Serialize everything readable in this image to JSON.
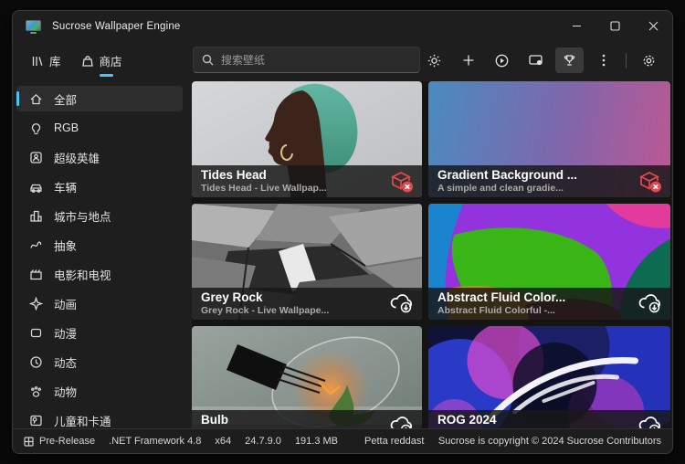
{
  "window": {
    "title": "Sucrose Wallpaper Engine"
  },
  "titlebar": {
    "controls": {
      "minimize": "minimize-icon",
      "maximize": "maximize-icon",
      "close": "close-icon"
    }
  },
  "nav": {
    "tabs": [
      {
        "label": "库",
        "icon": "library-icon",
        "active": false
      },
      {
        "label": "商店",
        "icon": "store-icon",
        "active": true
      }
    ]
  },
  "search": {
    "placeholder": "搜索壁纸",
    "value": "",
    "icon": "search-icon"
  },
  "toolbar": {
    "buttons": [
      {
        "icon": "brightness-icon"
      },
      {
        "icon": "add-icon"
      },
      {
        "icon": "play-icon"
      },
      {
        "icon": "apply-wallpaper-icon"
      },
      {
        "icon": "trophy-icon",
        "active": true
      },
      {
        "icon": "more-icon"
      },
      {
        "icon": "settings-icon"
      }
    ]
  },
  "sidebar": {
    "items": [
      {
        "label": "全部",
        "icon": "home-icon",
        "active": true
      },
      {
        "label": "RGB",
        "icon": "lightbulb-icon",
        "active": false
      },
      {
        "label": "超级英雄",
        "icon": "superhero-icon",
        "active": false
      },
      {
        "label": "车辆",
        "icon": "car-icon",
        "active": false
      },
      {
        "label": "城市与地点",
        "icon": "city-icon",
        "active": false
      },
      {
        "label": "抽象",
        "icon": "abstract-icon",
        "active": false
      },
      {
        "label": "电影和电视",
        "icon": "movie-icon",
        "active": false
      },
      {
        "label": "动画",
        "icon": "animation-icon",
        "active": false
      },
      {
        "label": "动漫",
        "icon": "anime-icon",
        "active": false
      },
      {
        "label": "动态",
        "icon": "dynamic-icon",
        "active": false
      },
      {
        "label": "动物",
        "icon": "animal-icon",
        "active": false
      },
      {
        "label": "儿童和卡通",
        "icon": "kids-cartoon-icon",
        "active": false
      }
    ]
  },
  "cards": [
    {
      "title": "Tides Head",
      "subtitle": "Tides Head - Live Wallpap...",
      "badge": "unavailable-box-icon"
    },
    {
      "title": "Gradient Background ...",
      "subtitle": "A simple and clean gradie...",
      "badge": "unavailable-box-icon"
    },
    {
      "title": "Grey Rock",
      "subtitle": "Grey Rock - Live Wallpape...",
      "badge": "cloud-download-icon"
    },
    {
      "title": "Abstract Fluid Color...",
      "subtitle": "Abstract Fluid Colorful -...",
      "badge": "cloud-download-icon"
    },
    {
      "title": "Bulb",
      "subtitle": "",
      "badge": "cloud-download-icon"
    },
    {
      "title": "ROG 2024",
      "subtitle": "",
      "badge": "cloud-download-icon"
    }
  ],
  "statusbar": {
    "icon": "package-icon",
    "items": [
      "Pre-Release",
      ".NET Framework 4.8",
      "x64",
      "24.7.9.0",
      "191.3 MB"
    ],
    "center": "Petta reddast",
    "copyright": "Sucrose is copyright © 2024 Sucrose Contributors"
  },
  "colors": {
    "accent": "#4cc2ff",
    "danger": "#e5484d",
    "window_bg": "#1e1e1e",
    "content_bg": "#141414"
  }
}
